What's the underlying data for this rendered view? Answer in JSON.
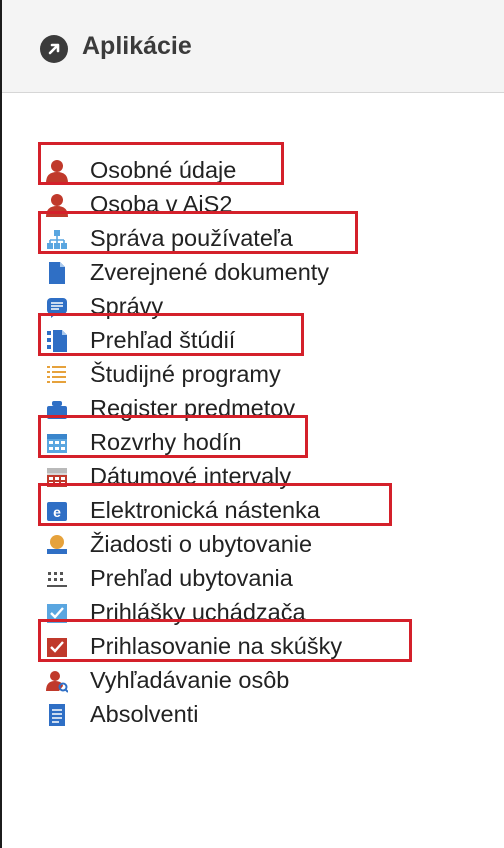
{
  "header": {
    "title": "Aplikácie",
    "icon": "external-link-circle-icon"
  },
  "menu": {
    "items": [
      {
        "label": "Osobné údaje",
        "icon": "person-icon",
        "highlighted": true
      },
      {
        "label": "Osoba v AiS2",
        "icon": "person-icon",
        "highlighted": false
      },
      {
        "label": "Správa používateľa",
        "icon": "org-chart-icon",
        "highlighted": true
      },
      {
        "label": "Zverejnené dokumenty",
        "icon": "document-icon",
        "highlighted": false
      },
      {
        "label": "Správy",
        "icon": "message-icon",
        "highlighted": false
      },
      {
        "label": "Prehľad štúdií",
        "icon": "document-list-icon",
        "highlighted": true
      },
      {
        "label": "Študijné programy",
        "icon": "list-icon",
        "highlighted": false
      },
      {
        "label": "Register predmetov",
        "icon": "register-icon",
        "highlighted": false
      },
      {
        "label": "Rozvrhy hodín",
        "icon": "calendar-icon",
        "highlighted": true
      },
      {
        "label": "Dátumové intervaly",
        "icon": "calendar-range-icon",
        "highlighted": false
      },
      {
        "label": "Elektronická nástenka",
        "icon": "e-board-icon",
        "highlighted": true
      },
      {
        "label": "Žiadosti o ubytovanie",
        "icon": "bed-request-icon",
        "highlighted": false
      },
      {
        "label": "Prehľad ubytovania",
        "icon": "grid-dots-icon",
        "highlighted": false
      },
      {
        "label": "Prihlášky uchádzača",
        "icon": "application-check-icon",
        "highlighted": false
      },
      {
        "label": "Prihlasovanie na skúšky",
        "icon": "exam-check-icon",
        "highlighted": true
      },
      {
        "label": "Vyhľadávanie osôb",
        "icon": "person-search-icon",
        "highlighted": false
      },
      {
        "label": "Absolventi",
        "icon": "graduates-doc-icon",
        "highlighted": false
      }
    ]
  },
  "colors": {
    "highlight": "#d4202a",
    "person": "#c0392b",
    "blue": "#2f6fc5",
    "light_blue": "#5aa6e0",
    "orange": "#e6a23c"
  }
}
